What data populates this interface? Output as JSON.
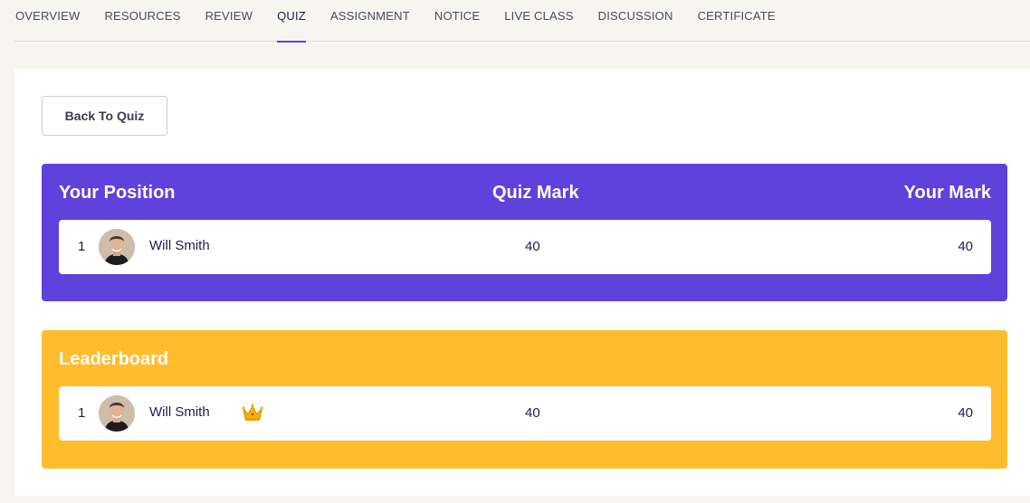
{
  "tabs": [
    {
      "label": "OVERVIEW",
      "active": false
    },
    {
      "label": "RESOURCES",
      "active": false
    },
    {
      "label": "REVIEW",
      "active": false
    },
    {
      "label": "QUIZ",
      "active": true
    },
    {
      "label": "ASSIGNMENT",
      "active": false
    },
    {
      "label": "NOTICE",
      "active": false
    },
    {
      "label": "LIVE CLASS",
      "active": false
    },
    {
      "label": "DISCUSSION",
      "active": false
    },
    {
      "label": "CERTIFICATE",
      "active": false
    }
  ],
  "back_button": {
    "label": "Back To Quiz"
  },
  "position_card": {
    "header": {
      "left": "Your Position",
      "middle": "Quiz Mark",
      "right": "Your Mark"
    },
    "row": {
      "rank": "1",
      "name": "Will Smith",
      "quiz_mark": "40",
      "your_mark": "40",
      "avatar_icon": "user-avatar"
    },
    "color": "#5f41db"
  },
  "leaderboard_card": {
    "header": {
      "left": "Leaderboard"
    },
    "row": {
      "rank": "1",
      "name": "Will Smith",
      "quiz_mark": "40",
      "your_mark": "40",
      "avatar_icon": "user-avatar",
      "badge_icon": "crown-icon"
    },
    "color": "#ffbd2e"
  },
  "colors": {
    "accent": "#5f41db",
    "leader": "#ffbd2e",
    "background": "#f6f5f0"
  }
}
